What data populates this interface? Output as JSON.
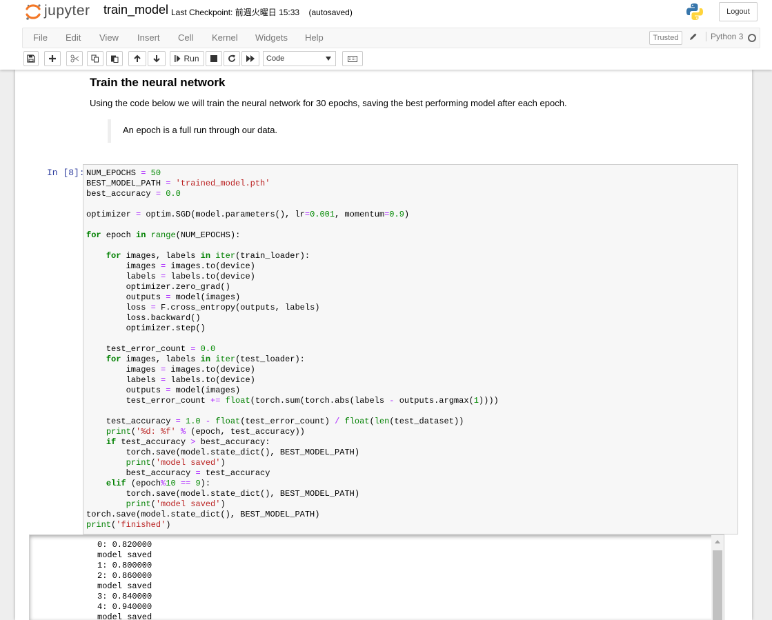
{
  "header": {
    "logo_text": "jupyter",
    "notebook_title": "train_model",
    "checkpoint_label": "Last Checkpoint:",
    "checkpoint_time": "前週火曜日 15:33",
    "autosave_status": "(autosaved)",
    "logout_label": "Logout"
  },
  "menu": {
    "items": [
      "File",
      "Edit",
      "View",
      "Insert",
      "Cell",
      "Kernel",
      "Widgets",
      "Help"
    ],
    "trusted_label": "Trusted",
    "kernel_name": "Python 3"
  },
  "toolbar": {
    "run_label": "Run",
    "cell_type": "Code",
    "icons": [
      "save-icon",
      "plus-icon",
      "cut-icon",
      "copy-icon",
      "paste-icon",
      "arrow-up-icon",
      "arrow-down-icon",
      "step-forward-icon",
      "stop-icon",
      "restart-icon",
      "fast-forward-icon",
      "keyboard-icon"
    ]
  },
  "markdown": {
    "heading": "Train the neural network",
    "paragraph": "Using the code below we will train the neural network for 30 epochs, saving the best performing model after each epoch.",
    "blockquote": "An epoch is a full run through our data."
  },
  "code_cell": {
    "prompt": "In [8]:",
    "source": [
      "NUM_EPOCHS = 50",
      "BEST_MODEL_PATH = 'trained_model.pth'",
      "best_accuracy = 0.0",
      "",
      "optimizer = optim.SGD(model.parameters(), lr=0.001, momentum=0.9)",
      "",
      "for epoch in range(NUM_EPOCHS):",
      "",
      "    for images, labels in iter(train_loader):",
      "        images = images.to(device)",
      "        labels = labels.to(device)",
      "        optimizer.zero_grad()",
      "        outputs = model(images)",
      "        loss = F.cross_entropy(outputs, labels)",
      "        loss.backward()",
      "        optimizer.step()",
      "",
      "    test_error_count = 0.0",
      "    for images, labels in iter(test_loader):",
      "        images = images.to(device)",
      "        labels = labels.to(device)",
      "        outputs = model(images)",
      "        test_error_count += float(torch.sum(torch.abs(labels - outputs.argmax(1))))",
      "",
      "    test_accuracy = 1.0 - float(test_error_count) / float(len(test_dataset))",
      "    print('%d: %f' % (epoch, test_accuracy))",
      "    if test_accuracy > best_accuracy:",
      "        torch.save(model.state_dict(), BEST_MODEL_PATH)",
      "        print('model saved')",
      "        best_accuracy = test_accuracy",
      "    elif (epoch%10 == 9):",
      "        torch.save(model.state_dict(), BEST_MODEL_PATH)",
      "        print('model saved')",
      "torch.save(model.state_dict(), BEST_MODEL_PATH)",
      "print('finished')"
    ]
  },
  "output": {
    "lines": [
      "0: 0.820000",
      "model saved",
      "1: 0.800000",
      "2: 0.860000",
      "model saved",
      "3: 0.840000",
      "4: 0.940000",
      "model saved"
    ]
  },
  "colors": {
    "keyword": "#008000",
    "operator": "#aa22ff",
    "number": "#008800",
    "string": "#ba2121",
    "prompt": "#303f9f",
    "logo_orange": "#f37726"
  }
}
